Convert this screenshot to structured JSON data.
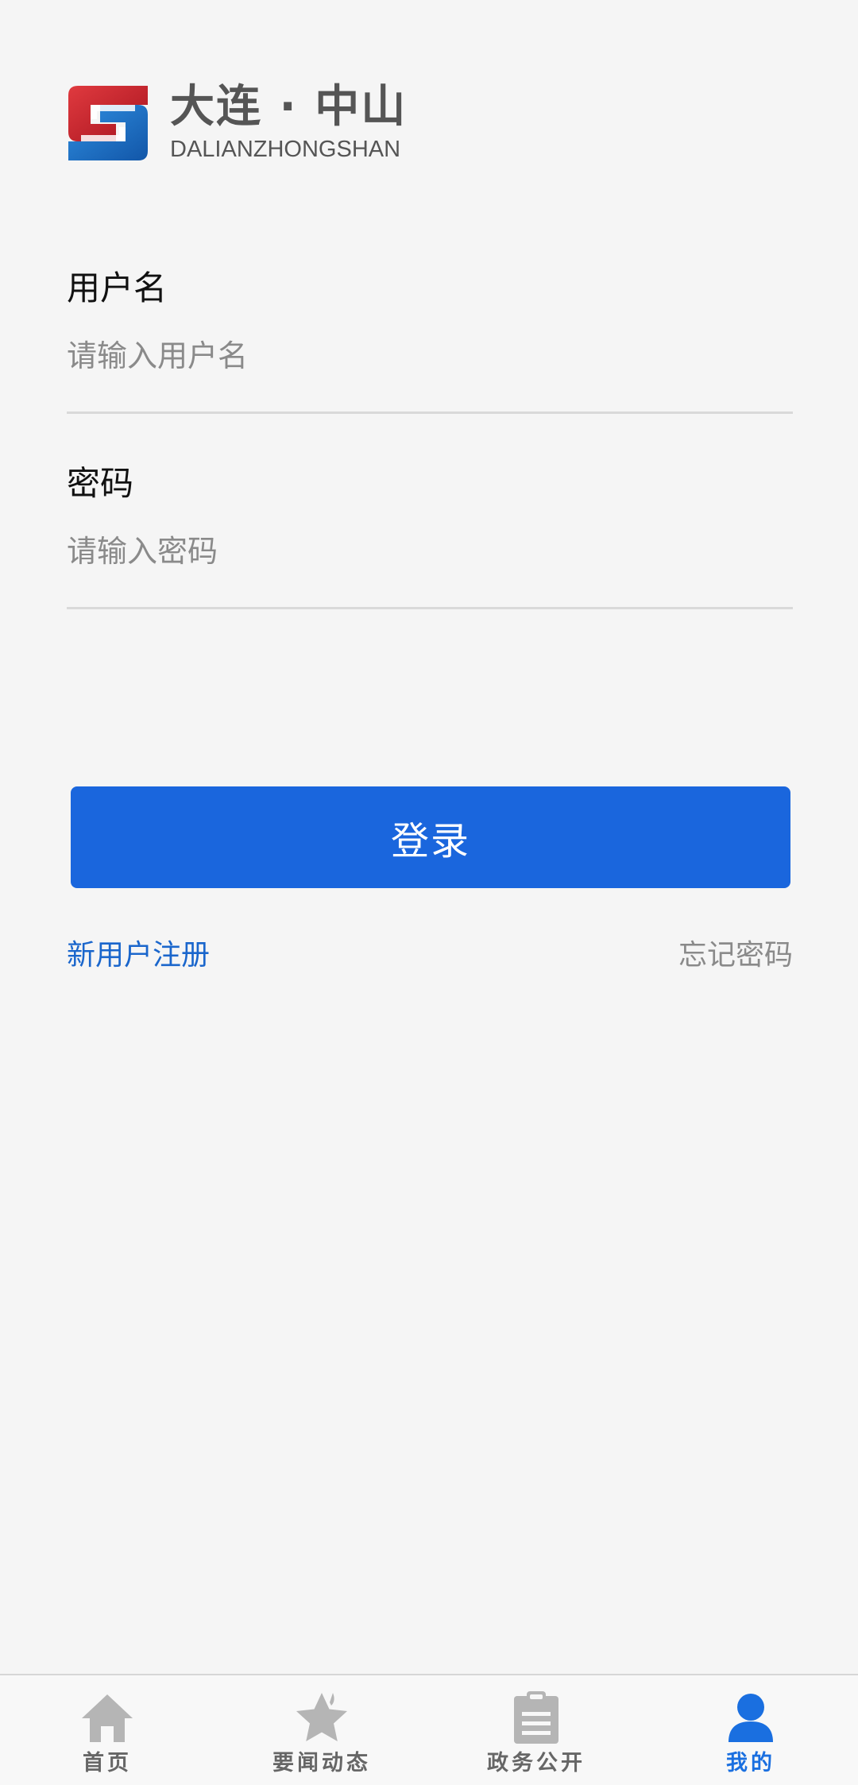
{
  "logo": {
    "chinese": "大连 · 中山",
    "english": "DALIANZHONGSHAN",
    "icon": "dalian-zhongshan-logo-icon"
  },
  "form": {
    "username": {
      "label": "用户名",
      "placeholder": "请输入用户名",
      "value": ""
    },
    "password": {
      "label": "密码",
      "placeholder": "请输入密码",
      "value": ""
    },
    "login_label": "登录",
    "register_label": "新用户注册",
    "forgot_label": "忘记密码"
  },
  "tabbar": {
    "active": "我的",
    "items": [
      {
        "label": "首页",
        "icon": "home-icon"
      },
      {
        "label": "要闻动态",
        "icon": "star-icon"
      },
      {
        "label": "政务公开",
        "icon": "clipboard-icon"
      },
      {
        "label": "我的",
        "icon": "user-icon"
      }
    ]
  },
  "colors": {
    "primary": "#1a66dd",
    "link": "#1a66cc",
    "tab_active": "#1a6fe0",
    "tab_inactive_icon": "#b5b5b5",
    "background": "#f5f5f5",
    "logo_red": "#c8202c",
    "logo_blue": "#1a6fc4"
  }
}
